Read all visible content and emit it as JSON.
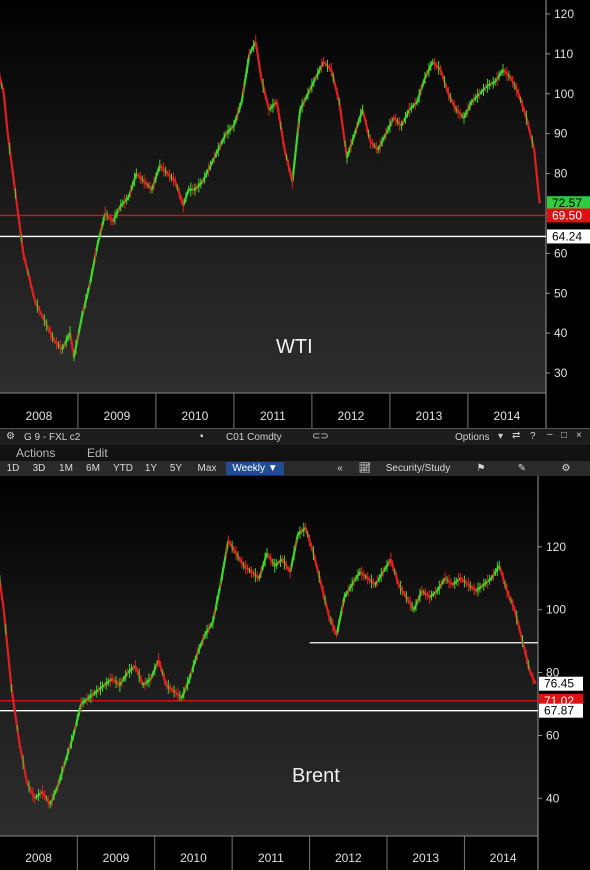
{
  "window": {
    "group": "G 9 - FXL c2",
    "security": "C01 Comdty",
    "options_label": "Options"
  },
  "menu": {
    "actions": "Actions",
    "edit": "Edit"
  },
  "toolbar": {
    "ranges": [
      "1D",
      "3D",
      "1M",
      "6M",
      "YTD",
      "1Y",
      "5Y",
      "Max"
    ],
    "frequency": "Weekly",
    "security_study": "Security/Study"
  },
  "chart_data": [
    {
      "type": "candlestick-line",
      "title": "WTI",
      "x_ticks": [
        "2008",
        "2009",
        "2010",
        "2011",
        "2012",
        "2013",
        "2014"
      ],
      "y_ticks": [
        30,
        40,
        50,
        60,
        70,
        80,
        90,
        100,
        110,
        120
      ],
      "ylim": [
        25,
        122
      ],
      "price_labels": [
        {
          "value": "72.57",
          "color": "#2ecc40"
        },
        {
          "value": "69.50",
          "color": "#e01010"
        },
        {
          "value": "64.24",
          "color": "#ffffff"
        }
      ],
      "hlines": [
        {
          "y": 69.5,
          "color": "#e01010"
        },
        {
          "y": 64.24,
          "color": "#ffffff"
        }
      ],
      "series": [
        {
          "x": [
            2007.75,
            2007.85,
            2007.95,
            2008.05,
            2008.1,
            2008.2,
            2008.3,
            2008.45,
            2008.6,
            2008.7,
            2008.8,
            2008.9,
            2008.95,
            2009.05,
            2009.15,
            2009.25,
            2009.35,
            2009.45,
            2009.55,
            2009.65,
            2009.75,
            2009.85,
            2009.95,
            2010.05,
            2010.15,
            2010.25,
            2010.35,
            2010.42,
            2010.5,
            2010.6,
            2010.7,
            2010.8,
            2010.9,
            2011.0,
            2011.1,
            2011.2,
            2011.28,
            2011.35,
            2011.45,
            2011.55,
            2011.65,
            2011.75,
            2011.85,
            2011.95,
            2012.05,
            2012.15,
            2012.25,
            2012.35,
            2012.45,
            2012.55,
            2012.65,
            2012.75,
            2012.85,
            2012.95,
            2013.05,
            2013.15,
            2013.25,
            2013.35,
            2013.45,
            2013.55,
            2013.65,
            2013.75,
            2013.85,
            2013.95,
            2014.05,
            2014.15,
            2014.25,
            2014.35,
            2014.45,
            2014.55,
            2014.65,
            2014.75,
            2014.85,
            2014.92
          ],
          "values": [
            90,
            100,
            108,
            100,
            90,
            75,
            60,
            48,
            42,
            38,
            36,
            40,
            34,
            44,
            52,
            62,
            70,
            68,
            72,
            74,
            80,
            78,
            76,
            82,
            80,
            78,
            72,
            76,
            76,
            78,
            82,
            86,
            90,
            92,
            98,
            110,
            113,
            104,
            96,
            98,
            86,
            78,
            96,
            100,
            104,
            108,
            106,
            98,
            84,
            90,
            96,
            88,
            86,
            90,
            94,
            92,
            96,
            98,
            104,
            108,
            106,
            100,
            96,
            94,
            98,
            100,
            102,
            103,
            106,
            104,
            100,
            94,
            86,
            72.57
          ]
        }
      ]
    },
    {
      "type": "candlestick-line",
      "title": "Brent",
      "x_ticks": [
        "2008",
        "2009",
        "2010",
        "2011",
        "2012",
        "2013",
        "2014"
      ],
      "y_ticks": [
        40,
        60,
        80,
        100,
        120
      ],
      "ylim": [
        28,
        140
      ],
      "price_labels": [
        {
          "value": "76.45",
          "color": "#ffffff"
        },
        {
          "value": "71.02",
          "color": "#e01010"
        },
        {
          "value": "67.87",
          "color": "#ffffff"
        }
      ],
      "hlines": [
        {
          "y": 71.02,
          "color": "#e01010"
        },
        {
          "y": 67.87,
          "color": "#ffffff"
        }
      ],
      "series": [
        {
          "x": [
            2007.95,
            2008.05,
            2008.15,
            2008.25,
            2008.35,
            2008.45,
            2008.55,
            2008.65,
            2008.75,
            2008.85,
            2008.95,
            2009.05,
            2009.15,
            2009.25,
            2009.35,
            2009.45,
            2009.55,
            2009.65,
            2009.75,
            2009.85,
            2009.95,
            2010.05,
            2010.15,
            2010.25,
            2010.35,
            2010.45,
            2010.55,
            2010.65,
            2010.75,
            2010.85,
            2010.95,
            2011.05,
            2011.15,
            2011.25,
            2011.35,
            2011.45,
            2011.55,
            2011.65,
            2011.75,
            2011.85,
            2011.95,
            2012.05,
            2012.15,
            2012.25,
            2012.35,
            2012.45,
            2012.55,
            2012.65,
            2012.75,
            2012.85,
            2012.95,
            2013.05,
            2013.15,
            2013.25,
            2013.35,
            2013.45,
            2013.55,
            2013.65,
            2013.75,
            2013.85,
            2013.95,
            2014.05,
            2014.15,
            2014.25,
            2014.35,
            2014.45,
            2014.55,
            2014.65,
            2014.75,
            2014.85,
            2014.92
          ],
          "values": [
            118,
            100,
            75,
            58,
            45,
            40,
            42,
            38,
            44,
            52,
            60,
            70,
            72,
            74,
            76,
            78,
            76,
            80,
            82,
            76,
            78,
            84,
            76,
            74,
            72,
            78,
            86,
            92,
            96,
            108,
            122,
            118,
            114,
            112,
            110,
            118,
            114,
            116,
            112,
            124,
            126,
            118,
            108,
            98,
            92,
            104,
            108,
            112,
            110,
            108,
            112,
            116,
            108,
            104,
            100,
            106,
            104,
            106,
            110,
            108,
            110,
            108,
            106,
            108,
            110,
            114,
            106,
            100,
            90,
            80,
            76.45
          ]
        }
      ],
      "extra_lines": [
        {
          "from_x": 2012.0,
          "to_x": 2014.95,
          "y": 89.5,
          "color": "#ffffff"
        }
      ]
    }
  ]
}
